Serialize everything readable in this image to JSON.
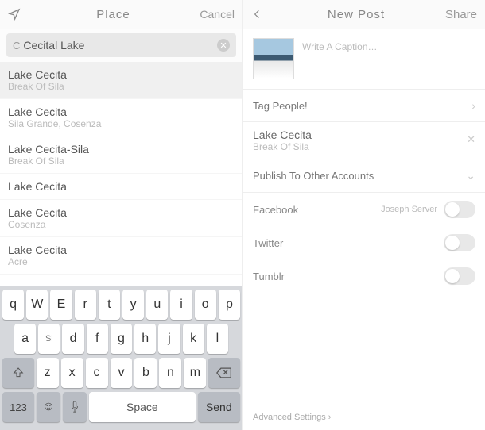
{
  "left": {
    "nav": {
      "title": "Place",
      "cancel": "Cancel"
    },
    "search": {
      "query": "Cecital Lake"
    },
    "results": [
      {
        "title": "Lake Cecita",
        "sub": "Break Of Sila",
        "selected": true
      },
      {
        "title": "Lake Cecita",
        "sub": "Sila Grande, Cosenza",
        "selected": false
      },
      {
        "title": "Lake Cecita-Sila",
        "sub": "Break Of Sila",
        "selected": false
      },
      {
        "title": "Lake Cecita",
        "sub": "",
        "selected": false
      },
      {
        "title": "Lake Cecita",
        "sub": "Cosenza",
        "selected": false
      },
      {
        "title": "Lake Cecita",
        "sub": "Acre",
        "selected": false
      }
    ],
    "keyboard": {
      "row1": [
        "q",
        "W",
        "E",
        "r",
        "t",
        "y",
        "u",
        "i",
        "o",
        "p"
      ],
      "row2": [
        "a",
        "Si",
        "d",
        "f",
        "g",
        "h",
        "j",
        "k",
        "l"
      ],
      "row3": [
        "z",
        "x",
        "c",
        "v",
        "b",
        "n",
        "m"
      ],
      "space": "Space",
      "send": "Send",
      "numkey": "123"
    }
  },
  "right": {
    "nav": {
      "title": "New Post",
      "share": "Share"
    },
    "caption_placeholder": "Write A Caption…",
    "tag_people": "Tag People!",
    "location": {
      "title": "Lake Cecita",
      "sub": "Break Of Sila"
    },
    "publish_header": "Publish To Other Accounts",
    "accounts": [
      {
        "label": "Facebook",
        "name": "Joseph Server"
      },
      {
        "label": "Twitter",
        "name": ""
      },
      {
        "label": "Tumblr",
        "name": ""
      }
    ],
    "advanced": "Advanced Settings"
  }
}
